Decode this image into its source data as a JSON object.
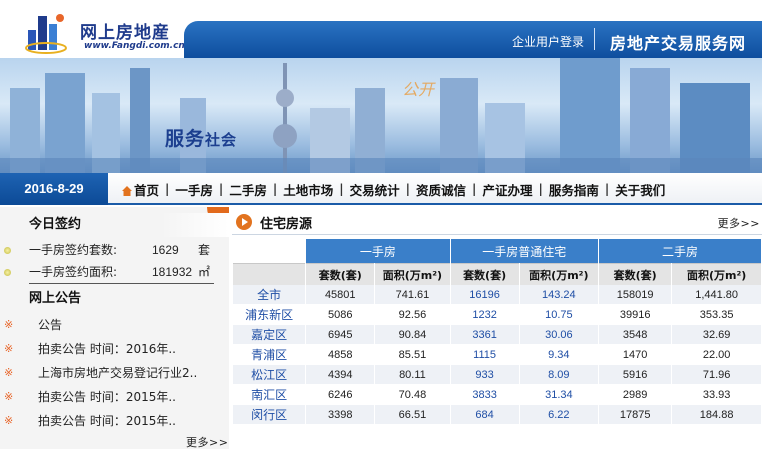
{
  "header": {
    "logo_name": "网上房地産",
    "logo_url": "www.Fangdi.com.cn",
    "login_link": "企业用户登录",
    "site_title": "房地产交易服务网"
  },
  "banner": {
    "slogan_main": "服务",
    "slogan_rest": "社会",
    "badge": "公开"
  },
  "nav": {
    "date": "2016-8-29",
    "items": [
      "首页",
      "一手房",
      "二手房",
      "土地市场",
      "交易统计",
      "资质诚信",
      "产证办理",
      "服务指南",
      "关于我们"
    ]
  },
  "left": {
    "today_title": "今日签约",
    "stats": [
      {
        "label": "一手房签约套数:",
        "value": "1629",
        "unit": "套"
      },
      {
        "label": "一手房签约面积:",
        "value": "181932",
        "unit": "㎡"
      }
    ],
    "notice_title": "网上公告",
    "notices": [
      "公告",
      "拍卖公告 时间：2016年..",
      "上海市房地产交易登记行业2..",
      "拍卖公告 时间：2015年..",
      "拍卖公告 时间：2015年.."
    ],
    "more": "更多>>"
  },
  "right": {
    "title": "住宅房源",
    "more": "更多>>",
    "groups": [
      "一手房",
      "一手房普通住宅",
      "二手房"
    ],
    "subheaders": [
      "套数(套)",
      "面积(万m²)",
      "套数(套)",
      "面积(万m²)",
      "套数(套)",
      "面积(万m²)"
    ],
    "rows": [
      [
        "全市",
        "45801",
        "741.61",
        "16196",
        "143.24",
        "158019",
        "1,441.80"
      ],
      [
        "浦东新区",
        "5086",
        "92.56",
        "1232",
        "10.75",
        "39916",
        "353.35"
      ],
      [
        "嘉定区",
        "6945",
        "90.84",
        "3361",
        "30.06",
        "3548",
        "32.69"
      ],
      [
        "青浦区",
        "4858",
        "85.51",
        "1115",
        "9.34",
        "1470",
        "22.00"
      ],
      [
        "松江区",
        "4394",
        "80.11",
        "933",
        "8.09",
        "5916",
        "71.96"
      ],
      [
        "南汇区",
        "6246",
        "70.48",
        "3833",
        "31.34",
        "2989",
        "33.93"
      ],
      [
        "闵行区",
        "3398",
        "66.51",
        "684",
        "6.22",
        "17875",
        "184.88"
      ]
    ]
  },
  "colors": {
    "brand_blue": "#1a5ba8",
    "header_blue": "#2a73c2",
    "accent_orange": "#e2731f",
    "table_group": "#3a7fc9"
  }
}
